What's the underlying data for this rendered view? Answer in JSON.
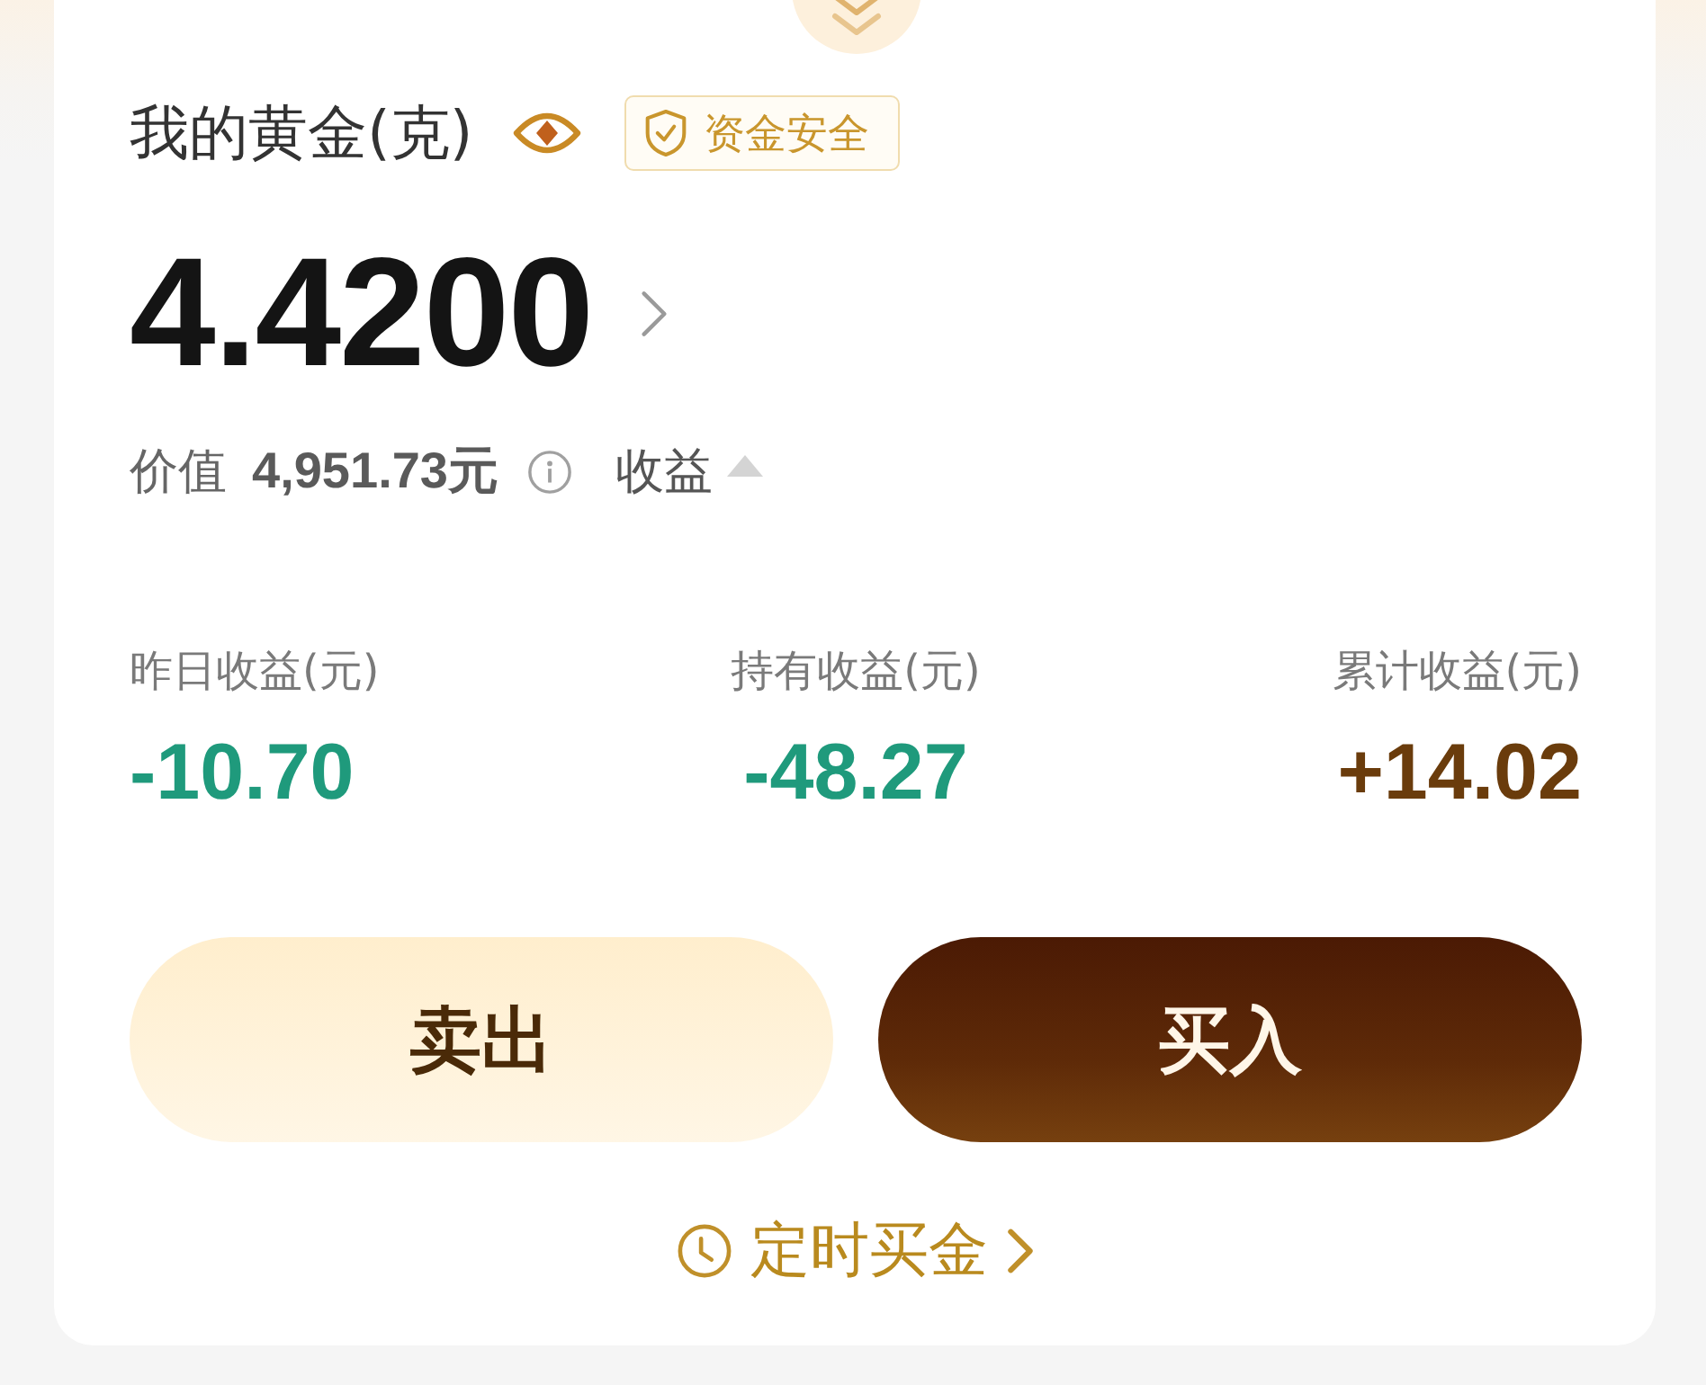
{
  "header": {
    "title": "我的黄金(克)",
    "badge": "资金安全"
  },
  "holding": {
    "amount": "4.4200",
    "value_label": "价值",
    "value": "4,951.73元",
    "earnings_toggle": {
      "label": "收益",
      "expanded": true
    }
  },
  "stats": [
    {
      "label": "昨日收益(元)",
      "value": "-10.70",
      "color": "#1f9a7c"
    },
    {
      "label": "持有收益(元)",
      "value": "-48.27",
      "color": "#1f9a7c"
    },
    {
      "label": "累计收益(元)",
      "value": "+14.02",
      "color": "#6a3c0c"
    }
  ],
  "actions": [
    {
      "label": "卖出",
      "kind": "secondary"
    },
    {
      "label": "买入",
      "kind": "primary"
    }
  ],
  "schedule_link": {
    "label": "定时买金"
  }
}
